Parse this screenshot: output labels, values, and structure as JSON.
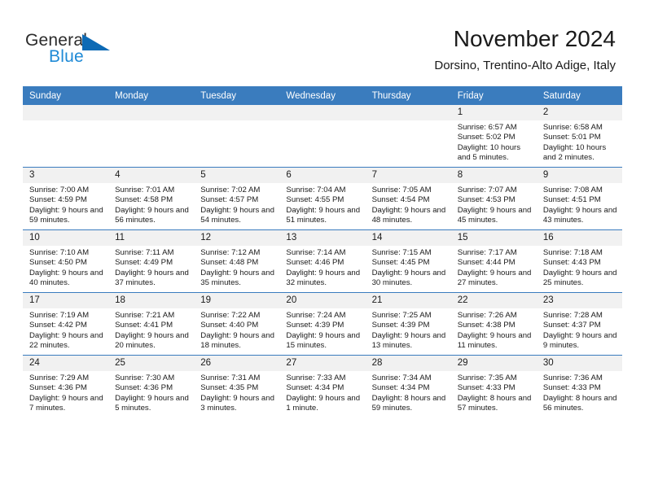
{
  "brand": {
    "name_top": "General",
    "name_bottom": "Blue",
    "triangle_color": "#0d6ab5",
    "top_text_color": "#2b2b2b",
    "bottom_text_color": "#1f8ad6"
  },
  "header": {
    "title": "November 2024",
    "subtitle": "Dorsino, Trentino-Alto Adige, Italy"
  },
  "colors": {
    "header_row_background": "#3a7cbe",
    "header_row_text": "#ffffff",
    "daynumber_band": "#f1f1f1",
    "cell_background": "#ffffff",
    "row_divider": "#3a7cbe"
  },
  "weekday_headers": [
    "Sunday",
    "Monday",
    "Tuesday",
    "Wednesday",
    "Thursday",
    "Friday",
    "Saturday"
  ],
  "labels": {
    "sunrise": "Sunrise:",
    "sunset": "Sunset:",
    "daylight": "Daylight:"
  },
  "weeks": [
    [
      {
        "day": "",
        "empty": true
      },
      {
        "day": "",
        "empty": true
      },
      {
        "day": "",
        "empty": true
      },
      {
        "day": "",
        "empty": true
      },
      {
        "day": "",
        "empty": true
      },
      {
        "day": "1",
        "sunrise": "Sunrise: 6:57 AM",
        "sunset": "Sunset: 5:02 PM",
        "daylight": "Daylight: 10 hours and 5 minutes."
      },
      {
        "day": "2",
        "sunrise": "Sunrise: 6:58 AM",
        "sunset": "Sunset: 5:01 PM",
        "daylight": "Daylight: 10 hours and 2 minutes."
      }
    ],
    [
      {
        "day": "3",
        "sunrise": "Sunrise: 7:00 AM",
        "sunset": "Sunset: 4:59 PM",
        "daylight": "Daylight: 9 hours and 59 minutes."
      },
      {
        "day": "4",
        "sunrise": "Sunrise: 7:01 AM",
        "sunset": "Sunset: 4:58 PM",
        "daylight": "Daylight: 9 hours and 56 minutes."
      },
      {
        "day": "5",
        "sunrise": "Sunrise: 7:02 AM",
        "sunset": "Sunset: 4:57 PM",
        "daylight": "Daylight: 9 hours and 54 minutes."
      },
      {
        "day": "6",
        "sunrise": "Sunrise: 7:04 AM",
        "sunset": "Sunset: 4:55 PM",
        "daylight": "Daylight: 9 hours and 51 minutes."
      },
      {
        "day": "7",
        "sunrise": "Sunrise: 7:05 AM",
        "sunset": "Sunset: 4:54 PM",
        "daylight": "Daylight: 9 hours and 48 minutes."
      },
      {
        "day": "8",
        "sunrise": "Sunrise: 7:07 AM",
        "sunset": "Sunset: 4:53 PM",
        "daylight": "Daylight: 9 hours and 45 minutes."
      },
      {
        "day": "9",
        "sunrise": "Sunrise: 7:08 AM",
        "sunset": "Sunset: 4:51 PM",
        "daylight": "Daylight: 9 hours and 43 minutes."
      }
    ],
    [
      {
        "day": "10",
        "sunrise": "Sunrise: 7:10 AM",
        "sunset": "Sunset: 4:50 PM",
        "daylight": "Daylight: 9 hours and 40 minutes."
      },
      {
        "day": "11",
        "sunrise": "Sunrise: 7:11 AM",
        "sunset": "Sunset: 4:49 PM",
        "daylight": "Daylight: 9 hours and 37 minutes."
      },
      {
        "day": "12",
        "sunrise": "Sunrise: 7:12 AM",
        "sunset": "Sunset: 4:48 PM",
        "daylight": "Daylight: 9 hours and 35 minutes."
      },
      {
        "day": "13",
        "sunrise": "Sunrise: 7:14 AM",
        "sunset": "Sunset: 4:46 PM",
        "daylight": "Daylight: 9 hours and 32 minutes."
      },
      {
        "day": "14",
        "sunrise": "Sunrise: 7:15 AM",
        "sunset": "Sunset: 4:45 PM",
        "daylight": "Daylight: 9 hours and 30 minutes."
      },
      {
        "day": "15",
        "sunrise": "Sunrise: 7:17 AM",
        "sunset": "Sunset: 4:44 PM",
        "daylight": "Daylight: 9 hours and 27 minutes."
      },
      {
        "day": "16",
        "sunrise": "Sunrise: 7:18 AM",
        "sunset": "Sunset: 4:43 PM",
        "daylight": "Daylight: 9 hours and 25 minutes."
      }
    ],
    [
      {
        "day": "17",
        "sunrise": "Sunrise: 7:19 AM",
        "sunset": "Sunset: 4:42 PM",
        "daylight": "Daylight: 9 hours and 22 minutes."
      },
      {
        "day": "18",
        "sunrise": "Sunrise: 7:21 AM",
        "sunset": "Sunset: 4:41 PM",
        "daylight": "Daylight: 9 hours and 20 minutes."
      },
      {
        "day": "19",
        "sunrise": "Sunrise: 7:22 AM",
        "sunset": "Sunset: 4:40 PM",
        "daylight": "Daylight: 9 hours and 18 minutes."
      },
      {
        "day": "20",
        "sunrise": "Sunrise: 7:24 AM",
        "sunset": "Sunset: 4:39 PM",
        "daylight": "Daylight: 9 hours and 15 minutes."
      },
      {
        "day": "21",
        "sunrise": "Sunrise: 7:25 AM",
        "sunset": "Sunset: 4:39 PM",
        "daylight": "Daylight: 9 hours and 13 minutes."
      },
      {
        "day": "22",
        "sunrise": "Sunrise: 7:26 AM",
        "sunset": "Sunset: 4:38 PM",
        "daylight": "Daylight: 9 hours and 11 minutes."
      },
      {
        "day": "23",
        "sunrise": "Sunrise: 7:28 AM",
        "sunset": "Sunset: 4:37 PM",
        "daylight": "Daylight: 9 hours and 9 minutes."
      }
    ],
    [
      {
        "day": "24",
        "sunrise": "Sunrise: 7:29 AM",
        "sunset": "Sunset: 4:36 PM",
        "daylight": "Daylight: 9 hours and 7 minutes."
      },
      {
        "day": "25",
        "sunrise": "Sunrise: 7:30 AM",
        "sunset": "Sunset: 4:36 PM",
        "daylight": "Daylight: 9 hours and 5 minutes."
      },
      {
        "day": "26",
        "sunrise": "Sunrise: 7:31 AM",
        "sunset": "Sunset: 4:35 PM",
        "daylight": "Daylight: 9 hours and 3 minutes."
      },
      {
        "day": "27",
        "sunrise": "Sunrise: 7:33 AM",
        "sunset": "Sunset: 4:34 PM",
        "daylight": "Daylight: 9 hours and 1 minute."
      },
      {
        "day": "28",
        "sunrise": "Sunrise: 7:34 AM",
        "sunset": "Sunset: 4:34 PM",
        "daylight": "Daylight: 8 hours and 59 minutes."
      },
      {
        "day": "29",
        "sunrise": "Sunrise: 7:35 AM",
        "sunset": "Sunset: 4:33 PM",
        "daylight": "Daylight: 8 hours and 57 minutes."
      },
      {
        "day": "30",
        "sunrise": "Sunrise: 7:36 AM",
        "sunset": "Sunset: 4:33 PM",
        "daylight": "Daylight: 8 hours and 56 minutes."
      }
    ]
  ]
}
